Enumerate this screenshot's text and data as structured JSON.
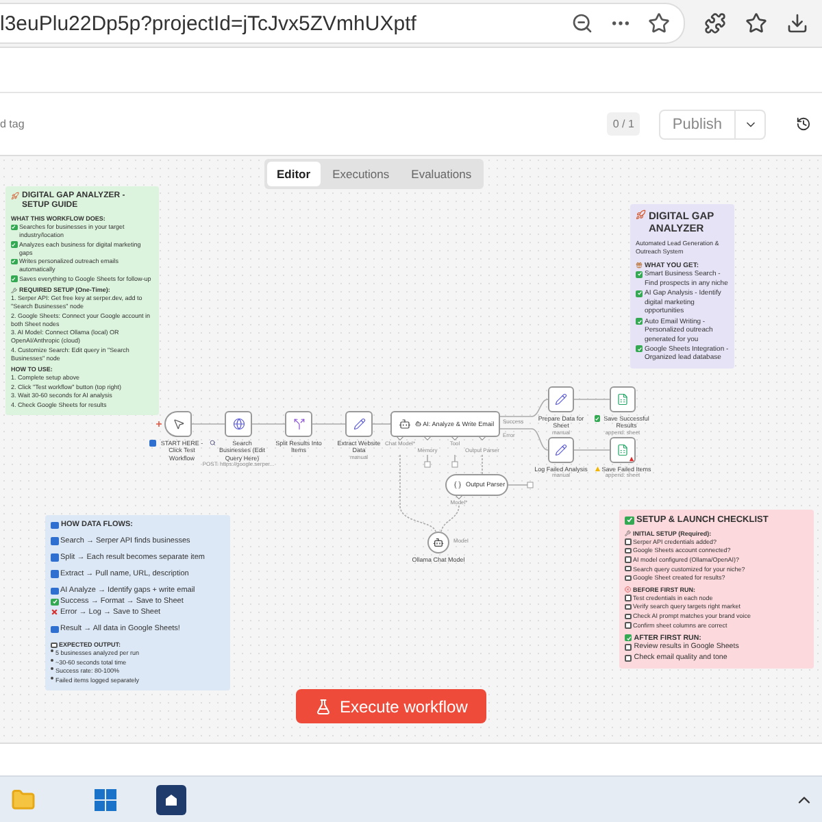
{
  "browser": {
    "url": "l3euPlu22Dp5p?projectId=jTcJvx5ZVmhUXptf"
  },
  "header": {
    "tag_text": "d tag",
    "version": "0 / 1",
    "publish": "Publish"
  },
  "tabs": [
    {
      "label": "Editor",
      "selected": true
    },
    {
      "label": "Executions",
      "selected": false
    },
    {
      "label": "Evaluations",
      "selected": false
    }
  ],
  "nodes": [
    {
      "kind": "trigger",
      "label": {
        "kind": "square",
        "text": "START HERE - Click Test Workflow"
      }
    },
    {
      "kind": "http",
      "label": {
        "kind": "search",
        "text": "Search Businesses (Edit Query Here)"
      },
      "subtitle": "POST: https://google.serper..."
    },
    {
      "kind": "split",
      "label": {
        "kind": "none",
        "text": "Split Results Into Items"
      }
    },
    {
      "kind": "edit",
      "label": {
        "kind": "none",
        "text": "Extract Website Data"
      },
      "subtitle": "manual"
    },
    {
      "kind": "agent",
      "label": {
        "kind": "robot",
        "text": "AI: Analyze & Write Email"
      },
      "port_labels": [
        "Chat Model*",
        "Memory",
        "Tool",
        "Output Parser",
        "Success",
        "Error"
      ]
    },
    {
      "kind": "edit",
      "label": {
        "kind": "none",
        "text": "Prepare Data for Sheet"
      },
      "subtitle": "manual"
    },
    {
      "kind": "sheets",
      "label": {
        "kind": "check",
        "text": "Save Successful Results"
      },
      "subtitle": "append: sheet"
    },
    {
      "kind": "edit",
      "label": {
        "kind": "none",
        "text": "Log Failed Analysis"
      },
      "subtitle": "manual"
    },
    {
      "kind": "sheets",
      "label": {
        "kind": "warning",
        "text": "Save Failed Items"
      },
      "subtitle": "append: sheet",
      "issue": true
    },
    {
      "kind": "parser",
      "label": {
        "kind": "none",
        "text": "Output Parser"
      },
      "port_labels": [
        "Model*"
      ]
    },
    {
      "kind": "model",
      "label": {
        "kind": "none",
        "text": "Ollama Chat Model"
      },
      "port_labels": [
        "Model"
      ]
    }
  ],
  "notes": [
    {
      "color": "#dcf3dd",
      "title": {
        "kind": "rocket",
        "text": "DIGITAL GAP ANALYZER - SETUP GUIDE"
      },
      "sections": [
        {
          "heading": {
            "kind": "none",
            "text": "WHAT THIS WORKFLOW DOES:"
          },
          "items": [
            {
              "kind": "check",
              "text": "Searches for businesses in your target industry/location"
            },
            {
              "kind": "check",
              "text": "Analyzes each business for digital marketing gaps"
            },
            {
              "kind": "check",
              "text": "Writes personalized outreach emails automatically"
            },
            {
              "kind": "check",
              "text": "Saves everything to Google Sheets for follow-up"
            }
          ]
        },
        {
          "heading": {
            "kind": "wrench",
            "text": "REQUIRED SETUP (One-Time):"
          },
          "items": [
            {
              "kind": "none",
              "text": "1. Serper API: Get free key at serper.dev, add to \"Search Businesses\" node"
            },
            {
              "kind": "none",
              "text": "2. Google Sheets: Connect your Google account in both Sheet nodes"
            },
            {
              "kind": "none",
              "text": "3. AI Model: Connect Ollama (local) OR OpenAI/Anthropic (cloud)"
            },
            {
              "kind": "none",
              "text": "4. Customize Search: Edit query in \"Search Businesses\" node"
            }
          ]
        },
        {
          "heading": {
            "kind": "none",
            "text": "HOW TO USE:"
          },
          "items": [
            {
              "kind": "none",
              "text": "1. Complete setup above"
            },
            {
              "kind": "none",
              "text": "2. Click \"Test workflow\" button (top right)"
            },
            {
              "kind": "none",
              "text": "3. Wait 30-60 seconds for AI analysis"
            },
            {
              "kind": "none",
              "text": "4. Check Google Sheets for results"
            }
          ]
        }
      ]
    },
    {
      "color": "#e6e3f6",
      "title": {
        "kind": "rocket",
        "text": "DIGITAL GAP ANALYZER"
      },
      "subtitle": "Automated Lead Generation & Outreach System",
      "sections": [
        {
          "heading": {
            "kind": "gift",
            "text": "WHAT YOU GET:"
          },
          "items": [
            {
              "kind": "check",
              "text": "Smart Business Search - Find prospects in any niche"
            },
            {
              "kind": "check",
              "text": "AI Gap Analysis - Identify digital marketing opportunities"
            },
            {
              "kind": "check",
              "text": "Auto Email Writing - Personalized outreach generated for you"
            },
            {
              "kind": "check",
              "text": "Google Sheets Integration - Organized lead database"
            }
          ]
        }
      ]
    },
    {
      "color": "#dce8f5",
      "title": {
        "kind": "step",
        "text": "HOW DATA FLOWS:"
      },
      "sections": [
        {
          "items": [
            {
              "kind": "step",
              "text": "Search → Serper API finds businesses"
            }
          ]
        },
        {
          "items": [
            {
              "kind": "step",
              "text": "Split → Each result becomes separate item"
            }
          ]
        },
        {
          "items": [
            {
              "kind": "step",
              "text": "Extract → Pull name, URL, description"
            }
          ]
        },
        {
          "items": [
            {
              "kind": "step",
              "text": "AI Analyze → Identify gaps + write email"
            },
            {
              "kind": "check",
              "text": "Success → Format → Save to Sheet"
            },
            {
              "kind": "cross",
              "text": "Error → Log → Save to Sheet"
            }
          ]
        },
        {
          "items": [
            {
              "kind": "step",
              "text": "Result → All data in Google Sheets!"
            }
          ]
        },
        {
          "heading": {
            "kind": "box",
            "text": "EXPECTED OUTPUT:"
          },
          "items": [
            {
              "kind": "bullet",
              "text": "5 businesses analyzed per run"
            },
            {
              "kind": "bullet",
              "text": "~30-60 seconds total time"
            },
            {
              "kind": "bullet",
              "text": "Success rate: 80-100%"
            },
            {
              "kind": "bullet",
              "text": "Failed items logged separately"
            }
          ]
        }
      ]
    },
    {
      "color": "#fbd9dc",
      "title": {
        "kind": "check",
        "text": "SETUP & LAUNCH CHECKLIST"
      },
      "sections": [
        {
          "heading": {
            "kind": "wrench",
            "text": "INITIAL SETUP (Required):"
          },
          "items": [
            {
              "kind": "box",
              "text": "Serper API credentials added?"
            },
            {
              "kind": "box",
              "text": "Google Sheets account connected?"
            },
            {
              "kind": "box",
              "text": "AI model configured (Ollama/OpenAI)?"
            },
            {
              "kind": "box",
              "text": "Search query customized for your niche?"
            },
            {
              "kind": "box",
              "text": "Google Sheet created for results?"
            }
          ]
        },
        {
          "heading": {
            "kind": "stop",
            "text": "BEFORE FIRST RUN:"
          },
          "items": [
            {
              "kind": "box",
              "text": "Test credentials in each node"
            },
            {
              "kind": "box",
              "text": "Verify search query targets right market"
            },
            {
              "kind": "box",
              "text": "Check AI prompt matches your brand voice"
            },
            {
              "kind": "box",
              "text": "Confirm sheet columns are correct"
            }
          ]
        },
        {
          "heading": {
            "kind": "check",
            "text": "AFTER FIRST RUN:"
          },
          "items": [
            {
              "kind": "box",
              "text": "Review results in Google Sheets"
            },
            {
              "kind": "box",
              "text": "Check email quality and tone"
            }
          ]
        }
      ]
    }
  ],
  "execute_button": "Execute workflow"
}
